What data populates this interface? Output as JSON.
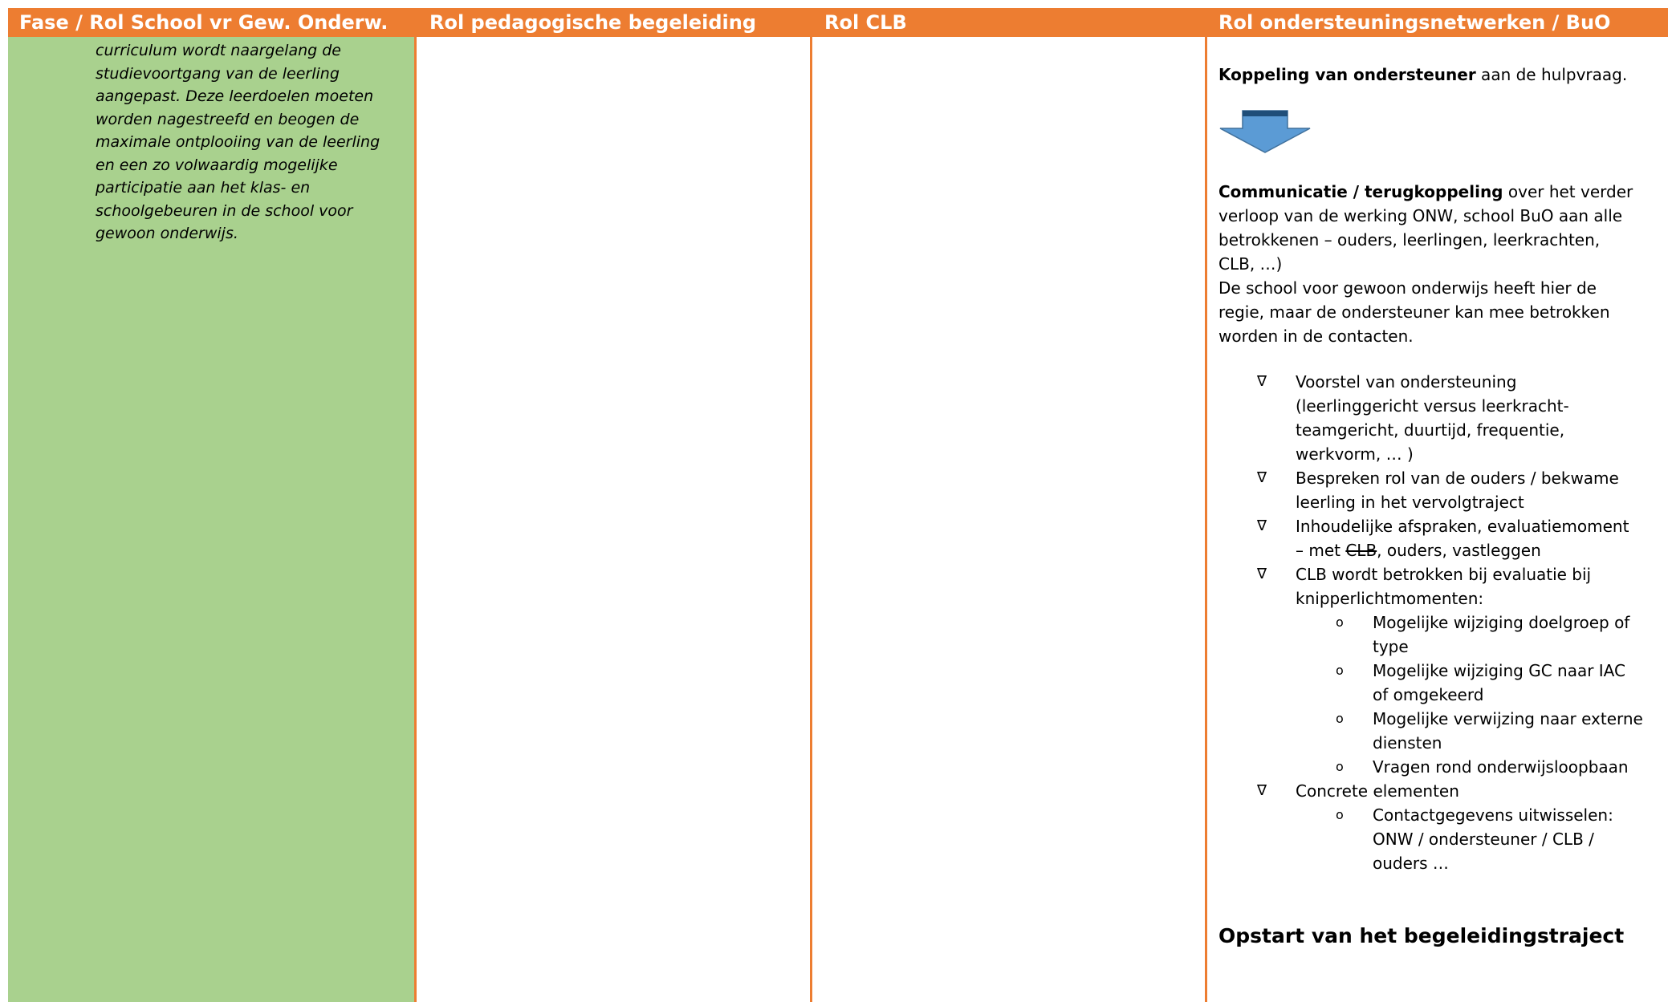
{
  "header": {
    "col1": "Fase / Rol School vr Gew. Onderw.",
    "col2": "Rol pedagogische begeleiding",
    "col3": "Rol CLB",
    "col4": "Rol ondersteuningsnetwerken / BuO"
  },
  "col1": {
    "lines": [
      "curriculum wordt naargelang de",
      "studievoortgang van de leerling",
      "aangepast. Deze leerdoelen moeten",
      "worden nagestreefd en beogen de",
      "maximale ontplooiing van de leerling",
      "en een zo volwaardig mogelijke",
      "participatie aan het klas- en",
      "schoolgebeuren in de school voor",
      "gewoon onderwijs."
    ]
  },
  "col4": {
    "koppeling_bold": "Koppeling van ondersteuner",
    "koppeling_rest": " aan de hulpvraag.",
    "arrow_icon": "down-arrow-icon",
    "comm_bold": "Communicatie / terugkoppeling",
    "comm_lines": [
      " over het verder",
      "verloop van de werking ONW, school BuO aan alle",
      "betrokkenen – ouders, leerlingen, leerkrachten,",
      "CLB, …)",
      "De school voor gewoon onderwijs heeft hier de",
      "regie, maar de ondersteuner kan mee betrokken",
      "worden in de contacten."
    ],
    "bullet_marker": "∇",
    "sub_marker": "o",
    "bullets": [
      {
        "lines": [
          "Voorstel van ondersteuning",
          "(leerlinggericht versus leerkracht-",
          "teamgericht, duurtijd, frequentie,",
          "werkvorm, … )"
        ]
      },
      {
        "lines": [
          "Bespreken rol van de ouders / bekwame",
          "leerling in het vervolgtraject"
        ]
      },
      {
        "line1": "Inhoudelijke afspraken, evaluatiemoment",
        "line2_pre": "– met ",
        "line2_strike": "CLB",
        "line2_post": ", ouders, vastleggen"
      },
      {
        "lines": [
          "CLB wordt betrokken bij evaluatie bij",
          "knipperlichtmomenten:"
        ],
        "sub": [
          [
            "Mogelijke wijziging doelgroep of",
            "type"
          ],
          [
            "Mogelijke wijziging GC naar IAC",
            "of omgekeerd"
          ],
          [
            "Mogelijke verwijzing naar externe",
            "diensten"
          ],
          [
            "Vragen rond onderwijsloopbaan"
          ]
        ]
      },
      {
        "lines": [
          "Concrete elementen"
        ],
        "sub": [
          [
            "Contactgegevens uitwisselen:",
            "ONW / ondersteuner / CLB /",
            "ouders …"
          ]
        ]
      }
    ],
    "opstart": "Opstart van het begeleidingstraject"
  },
  "colors": {
    "header": "#ed7d31",
    "col1_bg": "#a9d18e",
    "arrow_fill": "#5b9bd5",
    "arrow_top": "#1f4e79"
  }
}
